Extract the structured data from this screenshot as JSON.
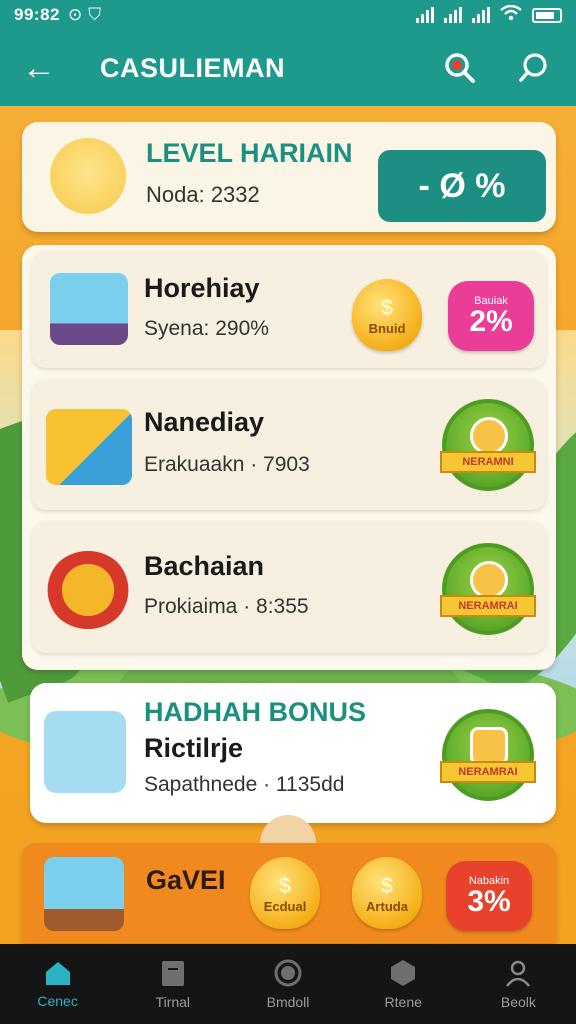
{
  "status": {
    "time": "99:82"
  },
  "appbar": {
    "title": "CASULIEMAN"
  },
  "header_card": {
    "title": "LEVEL HARIAIN",
    "subtitle": "Noda: 2332",
    "percent": "- Ø %"
  },
  "list": [
    {
      "title": "Horehiay",
      "subtitle": "Syena: 290%",
      "coin_label": "Bnuid",
      "pill_small": "Bauiak",
      "pill_value": "2%"
    },
    {
      "title": "Nanediay",
      "subtitle": "Erakuaakn · 7903",
      "badge_label": "NERAMNI"
    },
    {
      "title": "Bachaian",
      "subtitle": "Prokiaima · 8:355",
      "badge_label": "NERAMRAI"
    }
  ],
  "bonus_card": {
    "heading": "HADHAH BONUS",
    "title": "Rictilrje",
    "subtitle": "Sapathnede · 1135dd",
    "badge_label": "NERAMRAI"
  },
  "orange_card": {
    "title": "GaVEI",
    "coin1_label": "Ecdual",
    "coin2_label": "Artuda",
    "pill_small": "Nabakin",
    "pill_value": "3%"
  },
  "bottom_nav": [
    {
      "label": "Cenec",
      "icon": "home-icon"
    },
    {
      "label": "Tirnal",
      "icon": "document-icon"
    },
    {
      "label": "Bmdoll",
      "icon": "circle-icon"
    },
    {
      "label": "Rtene",
      "icon": "hexagon-icon"
    },
    {
      "label": "Beolk",
      "icon": "profile-icon"
    }
  ],
  "colors": {
    "primary": "#1d9a8c",
    "accent_orange": "#f08a1e",
    "nav_active": "#2bb3c4",
    "pink": "#e93d97",
    "red": "#e8412c",
    "green": "#5aa728"
  }
}
